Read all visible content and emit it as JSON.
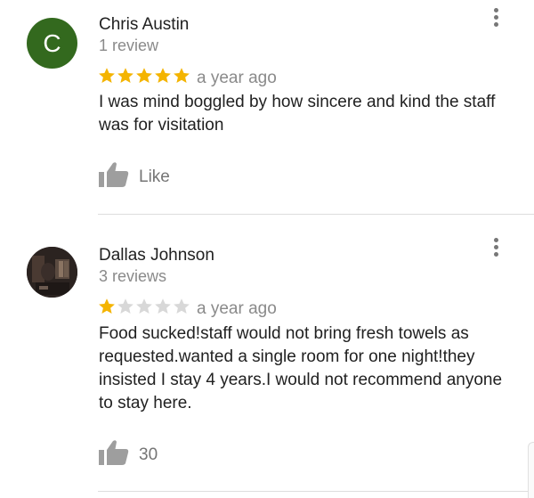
{
  "reviews": [
    {
      "avatar_letter": "C",
      "avatar_color": "#33691e",
      "name": "Chris Austin",
      "review_count": "1 review",
      "rating": 5,
      "max_rating": 5,
      "time_ago": "a year ago",
      "text": "I was mind boggled by how sincere and kind the staff was for visitation",
      "like_label": "Like",
      "menu_icon": "more-vert-icon",
      "like_icon": "thumbs-up-icon"
    },
    {
      "avatar_type": "photo",
      "name": "Dallas Johnson",
      "review_count": "3 reviews",
      "rating": 1,
      "max_rating": 5,
      "time_ago": "a year ago",
      "text": "Food sucked!staff would not bring fresh towels as requested.wanted a single room for one night!they insisted I stay 4 years.I would not recommend anyone to stay here.",
      "like_label": "30",
      "menu_icon": "more-vert-icon",
      "like_icon": "thumbs-up-icon"
    }
  ],
  "colors": {
    "star_filled": "#f4b400",
    "star_empty": "#d8d8d8",
    "secondary_text": "#8a8a8a",
    "divider": "#dddddd"
  }
}
